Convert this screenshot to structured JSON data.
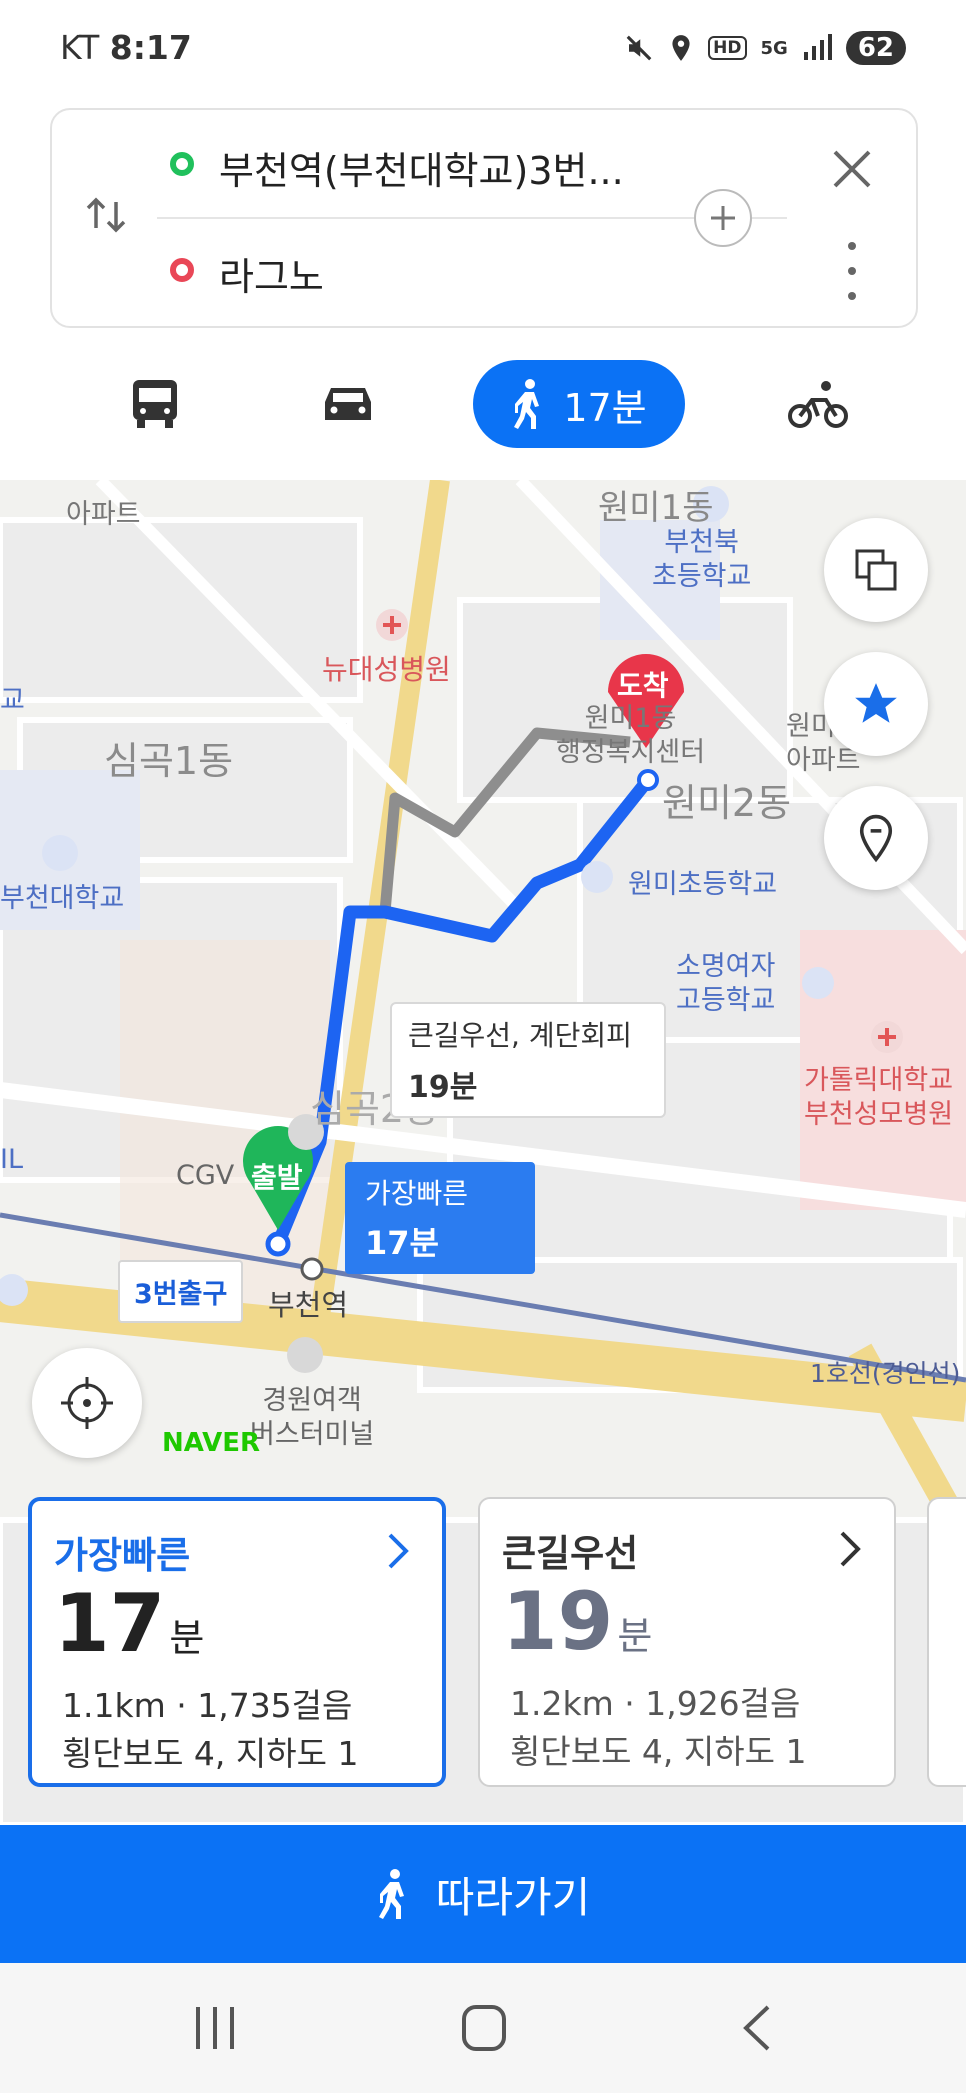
{
  "status_bar": {
    "carrier": "KT",
    "time": "8:17",
    "network": "5G",
    "hd": "HD",
    "battery": "62"
  },
  "route": {
    "origin": "부천역(부천대학교)3번...",
    "destination": "라그노"
  },
  "modes": {
    "walk_time": "17분",
    "active": "walk"
  },
  "map": {
    "labels": {
      "apt_top_left": "아파트",
      "wonmi_top": "원미1동",
      "bucheonbuk_school": "부천북\n초등학교",
      "hospital": "뉴대성병원",
      "simgok1": "심곡1동",
      "wonmi_center": "원미1동\n행정복지센터",
      "wonmi2": "원미2동",
      "wonmi_apt": "원미\n아파트",
      "bucheon_univ": "부천대학교",
      "wonmi_elementary": "원미초등학교",
      "somyeong_girls": "소명여자\n고등학교",
      "catholic_hospital": "가톨릭대학교\n부천성모병원",
      "cgv": "CGV",
      "simgok2": "심곡2동",
      "bucheon_station": "부천역",
      "line1": "1호선(경인선)",
      "bus_terminal": "경원여객\n버스터미널",
      "naver": "NAVER",
      "left_edge_1": "교",
      "left_edge_2": "IL"
    },
    "markers": {
      "start": "출발",
      "arrive": "도착",
      "exit": "3번출구"
    },
    "callouts": {
      "alt_route_name": "큰길우선, 계단회피",
      "alt_route_time": "19분",
      "fastest_name": "가장빠른",
      "fastest_time": "17분"
    }
  },
  "cards": [
    {
      "title": "가장빠른",
      "minutes": "17",
      "unit": "분",
      "distance": "1.1km · 1,735걸음",
      "crossings": "횡단보도 4, 지하도 1",
      "selected": true
    },
    {
      "title": "큰길우선",
      "minutes": "19",
      "unit": "분",
      "distance": "1.2km · 1,926걸음",
      "crossings": "횡단보도 4, 지하도 1",
      "selected": false
    }
  ],
  "follow_button": {
    "label": "따라가기"
  },
  "colors": {
    "accent": "#0b72f5",
    "start_green": "#1fb65a",
    "arrive_red": "#e8364a",
    "route_gray": "#8e8e8e"
  }
}
